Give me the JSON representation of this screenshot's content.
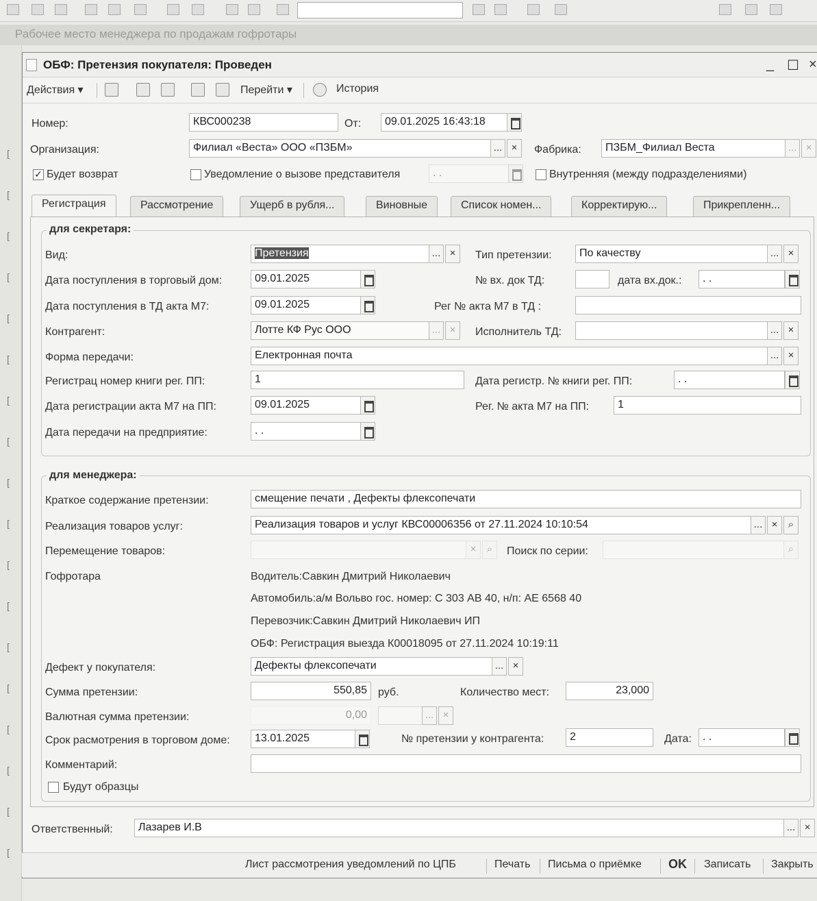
{
  "app": {
    "title": "Рабочее место менеджера по продажам гофротары"
  },
  "window": {
    "title": "ОБФ: Претензия покупателя: Проведен"
  },
  "toolbar": {
    "actions": "Действия",
    "goto": "Перейти",
    "history": "История"
  },
  "header": {
    "number_label": "Номер:",
    "number": "КВС000238",
    "from_label": "От:",
    "from": "09.01.2025 16:43:18",
    "org_label": "Организация:",
    "org": "Филиал «Веста» ООО «ПЗБМ»",
    "factory_label": "Фабрика:",
    "factory": "ПЗБМ_Филиал Веста",
    "return_label": "Будет возврат",
    "notify_label": "Уведомление о вызове представителя",
    "internal_label": "Внутренняя (между подразделениями)"
  },
  "tabs": [
    "Регистрация",
    "Рассмотрение",
    "Ущерб в рубля...",
    "Виновные",
    "Список номен...",
    "Корректирую...",
    "Прикрепленн..."
  ],
  "secretary": {
    "title": "для секретаря:",
    "kind_label": "Вид:",
    "kind": "Претензия",
    "claim_type_label": "Тип претензии:",
    "claim_type": "По качеству",
    "date_in_label": "Дата поступления в торговый дом:",
    "date_in": "09.01.2025",
    "in_doc_label": "№ вх. док ТД:",
    "in_doc_date_label": "дата вх.док.:",
    "in_doc_date": " .  .",
    "date_m7_label": "Дата поступления в ТД акта М7:",
    "date_m7": "09.01.2025",
    "reg_m7_td_label": "Рег № акта М7 в ТД :",
    "counterparty_label": "Контрагент:",
    "counterparty": "Лотте КФ Рус ООО",
    "executor_label": "Исполнитель ТД:",
    "form_label": "Форма передачи:",
    "form": "Електронная почта",
    "reg_book_label": "Регистрац номер книги рег. ПП:",
    "reg_book": "1",
    "reg_book_date_label": "Дата регистр. № книги рег. ПП:",
    "reg_book_date": " .  .",
    "reg_m7_date_label": "Дата регистрации акта М7 на ПП:",
    "reg_m7_date": "09.01.2025",
    "reg_m7_pp_label": "Рег. № акта М7 на ПП:",
    "reg_m7_pp": "1",
    "transfer_date_label": "Дата передачи на предприятие:",
    "transfer_date": " .  ."
  },
  "manager": {
    "title": "для менеджера:",
    "summary_label": "Краткое содержание претензии:",
    "summary": "смещение печати , Дефекты флексопечати",
    "sale_label": "Реализация товаров услуг:",
    "sale": "Реализация товаров и услуг КВС00006356 от 27.11.2024 10:10:54",
    "move_label": "Перемещение товаров:",
    "serial_label": "Поиск по серии:",
    "gofrotara_label": "Гофротара",
    "driver": "Водитель:Савкин Дмитрий Николаевич",
    "car": "Автомобиль:а/м Вольво гос. номер: С 303 АВ 40, н/п: АЕ 6568 40",
    "carrier": "Перевозчик:Савкин Дмитрий Николаевич ИП",
    "exit_reg": "ОБФ: Регистрация выезда К00018095 от 27.11.2024 10:19:11",
    "defect_label": "Дефект у покупателя:",
    "defect": "Дефекты флексопечати",
    "sum_label": "Сумма претензии:",
    "sum": "550,85",
    "currency": "руб.",
    "places_label": "Количество мест:",
    "places": "23,000",
    "fx_sum_label": "Валютная сумма претензии:",
    "fx_sum": "0,00",
    "term_label": "Срок расмотрения в торговом доме:",
    "term": "13.01.2025",
    "cp_claim_label": "№ претензии у контрагента:",
    "cp_claim": "2",
    "date_label": "Дата:",
    "date": " .  .",
    "comment_label": "Комментарий:",
    "samples_label": "Будут образцы"
  },
  "footer": {
    "responsible_label": "Ответственный:",
    "responsible": "Лазарев И.В",
    "btn_sheet": "Лист рассмотрения уведомлений по ЦПБ",
    "btn_print": "Печать",
    "btn_letters": "Письма о приёмке",
    "btn_ok": "OK",
    "btn_save": "Записать",
    "btn_close": "Закрыть"
  }
}
